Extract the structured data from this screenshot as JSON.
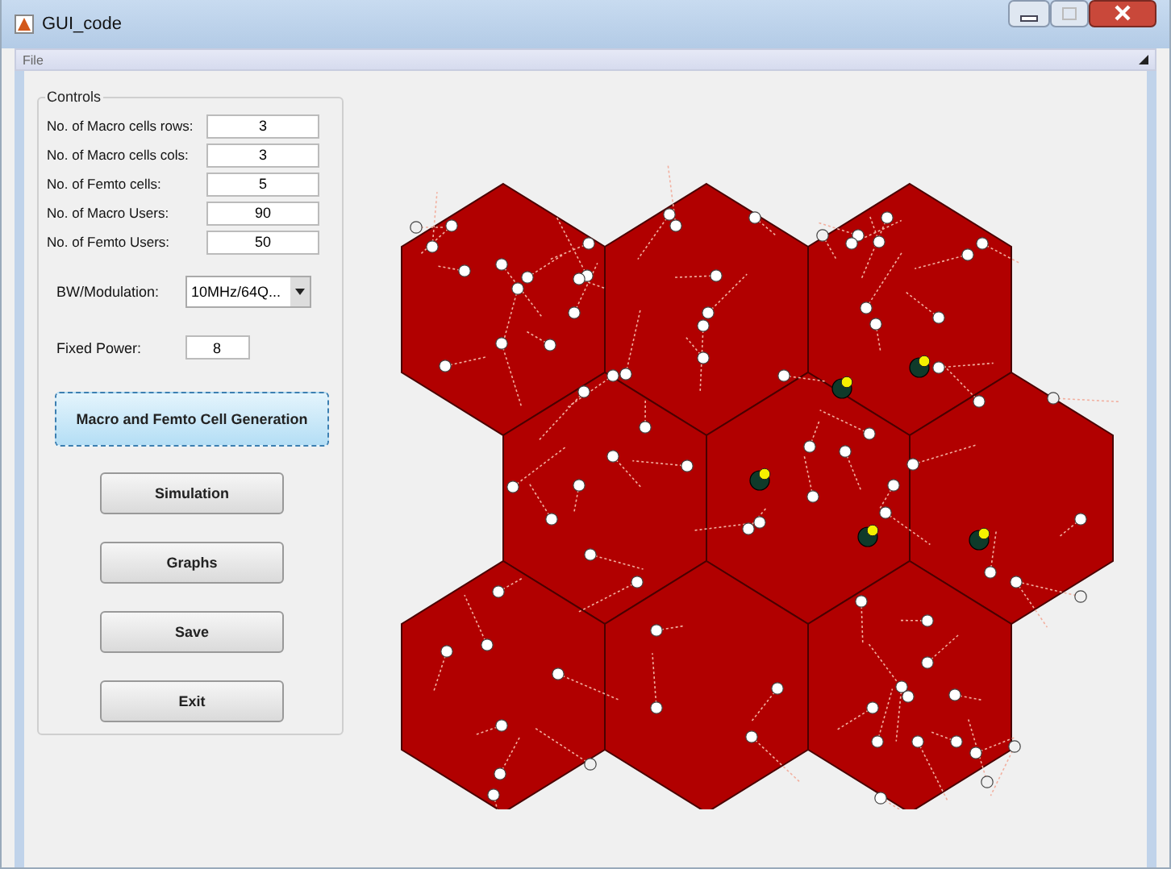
{
  "window": {
    "title": "GUI_code"
  },
  "menu": [
    "File"
  ],
  "controls": {
    "title": "Controls",
    "fields": [
      {
        "label": "No. of Macro cells rows:",
        "value": "3"
      },
      {
        "label": "No. of Macro cells cols:",
        "value": "3"
      },
      {
        "label": "No. of Femto cells:",
        "value": "5"
      },
      {
        "label": "No. of Macro Users:",
        "value": "90"
      },
      {
        "label": "No. of Femto Users:",
        "value": "50"
      }
    ],
    "bw_modulation": {
      "label": "BW/Modulation:",
      "value": "10MHz/64Q..."
    },
    "fixed_power": {
      "label": "Fixed Power:",
      "value": "8"
    },
    "buttons": [
      {
        "label": "Macro and Femto Cell Generation",
        "focused": true
      },
      {
        "label": "Simulation",
        "focused": false
      },
      {
        "label": "Graphs",
        "focused": false
      },
      {
        "label": "Save",
        "focused": false
      },
      {
        "label": "Exit",
        "focused": false
      }
    ]
  }
}
